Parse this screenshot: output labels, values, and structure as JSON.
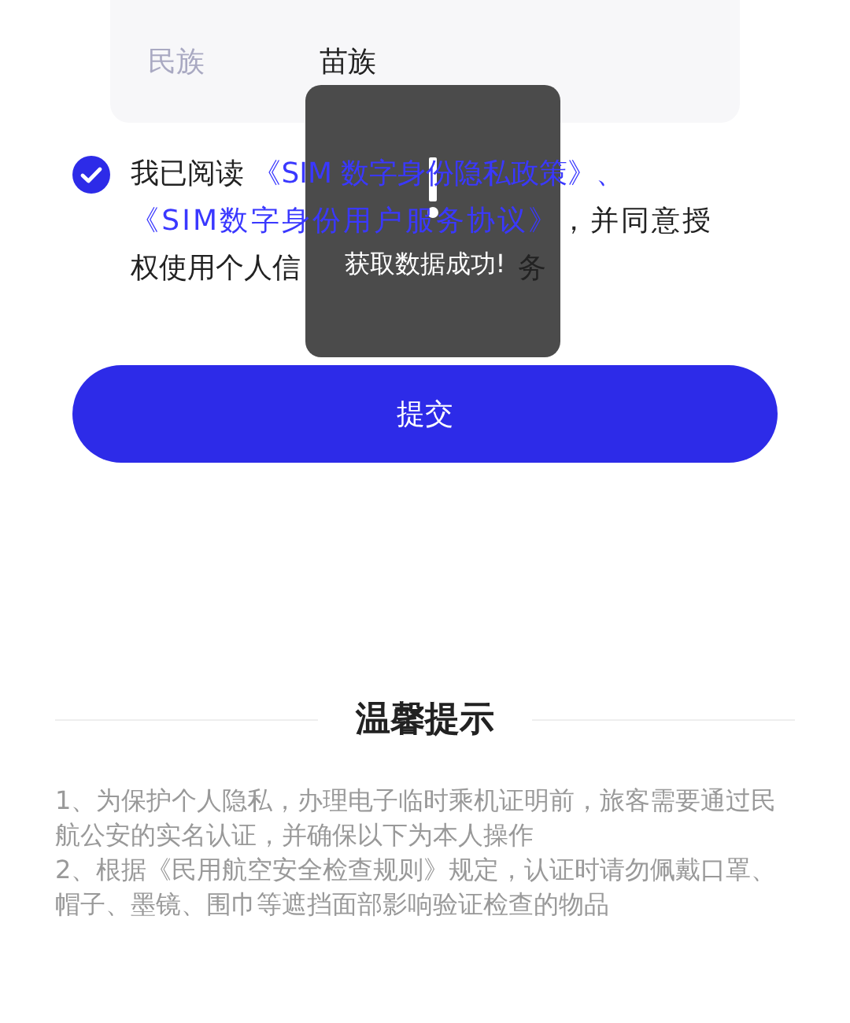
{
  "field": {
    "label": "民族",
    "value": "苗族"
  },
  "agreement": {
    "checked": true,
    "lead": "我已阅读 ",
    "links": [
      "《SIM 数字身份隐私政策》、",
      "《SIM数字身份用户服务协议》"
    ],
    "rest": "，并同意授",
    "line_3": "权使用个人信",
    "tail": "务"
  },
  "submit_button": "提交",
  "tips": {
    "title": "温馨提示",
    "items": [
      "1、为保护个人隐私，办理电子临时乘机证明前，旅客需要通过民航公安的实名认证，并确保以下为本人操作",
      "2、根据《民用航空安全检查规则》规定，认证时请勿佩戴口罩、帽子、墨镜、围巾等遮挡面部影响验证检查的物品"
    ]
  },
  "toast": {
    "message": "获取数据成功!"
  }
}
